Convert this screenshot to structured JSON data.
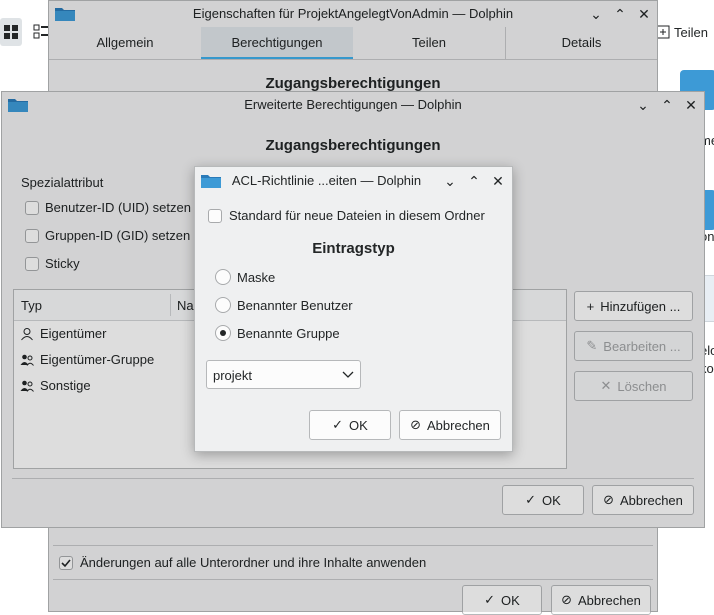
{
  "background_app": {
    "toolbar_right_label": "Teilen",
    "side_fragments": [
      "me",
      "on",
      "elo",
      "ko"
    ]
  },
  "properties_window": {
    "title": "Eigenschaften für ProjektAngelegtVonAdmin — Dolphin",
    "tabs": [
      {
        "label": "Allgemein"
      },
      {
        "label": "Berechtigungen"
      },
      {
        "label": "Teilen"
      },
      {
        "label": "Details"
      }
    ],
    "active_tab": "Berechtigungen",
    "partial_heading": "Zugangsberechtigungen",
    "apply_recursive_label": "Änderungen auf alle Unterordner und ihre Inhalte anwenden",
    "apply_recursive_checked": true,
    "ok_label": "OK",
    "cancel_label": "Abbrechen"
  },
  "advanced_window": {
    "title": "Erweiterte Berechtigungen — Dolphin",
    "heading": "Zugangsberechtigungen",
    "special_attr_label": "Spezialattribut",
    "special_attrs": [
      {
        "label": "Benutzer-ID (UID) setzen",
        "checked": false
      },
      {
        "label": "Gruppen-ID (GID) setzen",
        "checked": false
      },
      {
        "label": "Sticky",
        "checked": false
      }
    ],
    "table_headers": [
      "Typ",
      "Na"
    ],
    "rows": [
      {
        "type": "Eigentümer",
        "icon": "user-icon"
      },
      {
        "type": "Eigentümer-Gruppe",
        "icon": "group-icon"
      },
      {
        "type": "Sonstige",
        "icon": "others-icon"
      }
    ],
    "add_label": "Hinzufügen ...",
    "edit_label": "Bearbeiten ...",
    "delete_label": "Löschen",
    "ok_label": "OK",
    "cancel_label": "Abbrechen"
  },
  "acl_dialog": {
    "title": "ACL-Richtlinie ...eiten — Dolphin",
    "default_checkbox_label": "Standard für neue Dateien in diesem Ordner",
    "default_checked": false,
    "entry_type_heading": "Eintragstyp",
    "options": [
      {
        "label": "Maske",
        "selected": false
      },
      {
        "label": "Benannter Benutzer",
        "selected": false
      },
      {
        "label": "Benannte Gruppe",
        "selected": true
      }
    ],
    "group_select_value": "projekt",
    "ok_label": "OK",
    "cancel_label": "Abbrechen"
  }
}
